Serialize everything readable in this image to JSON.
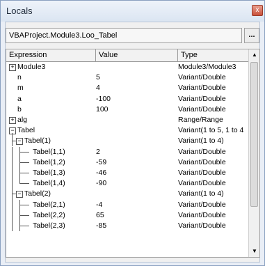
{
  "window": {
    "title": "Locals",
    "close_glyph": "x"
  },
  "context": {
    "value": "VBAProject.Module3.Loo_Tabel",
    "browse_label": "..."
  },
  "columns": {
    "expression": "Expression",
    "value": "Value",
    "type": "Type"
  },
  "rows": [
    {
      "name": "Module3",
      "value": "",
      "type": "Module3/Module3"
    },
    {
      "name": "n",
      "value": "5",
      "type": "Variant/Double"
    },
    {
      "name": "m",
      "value": "4",
      "type": "Variant/Double"
    },
    {
      "name": "a",
      "value": "-100",
      "type": "Variant/Double"
    },
    {
      "name": "b",
      "value": "100",
      "type": "Variant/Double"
    },
    {
      "name": "alg",
      "value": "",
      "type": "Range/Range"
    },
    {
      "name": "Tabel",
      "value": "",
      "type": "Variant(1 to 5, 1 to 4"
    },
    {
      "name": "Tabel(1)",
      "value": "",
      "type": "Variant(1 to 4)"
    },
    {
      "name": "Tabel(1,1)",
      "value": "2",
      "type": "Variant/Double"
    },
    {
      "name": "Tabel(1,2)",
      "value": "-59",
      "type": "Variant/Double"
    },
    {
      "name": "Tabel(1,3)",
      "value": "-46",
      "type": "Variant/Double"
    },
    {
      "name": "Tabel(1,4)",
      "value": "-90",
      "type": "Variant/Double"
    },
    {
      "name": "Tabel(2)",
      "value": "",
      "type": "Variant(1 to 4)"
    },
    {
      "name": "Tabel(2,1)",
      "value": "-4",
      "type": "Variant/Double"
    },
    {
      "name": "Tabel(2,2)",
      "value": "65",
      "type": "Variant/Double"
    },
    {
      "name": "Tabel(2,3)",
      "value": "-85",
      "type": "Variant/Double"
    }
  ],
  "scrollbar": {
    "up_icon": "scroll-up-arrow-icon",
    "down_icon": "scroll-down-arrow-icon"
  }
}
